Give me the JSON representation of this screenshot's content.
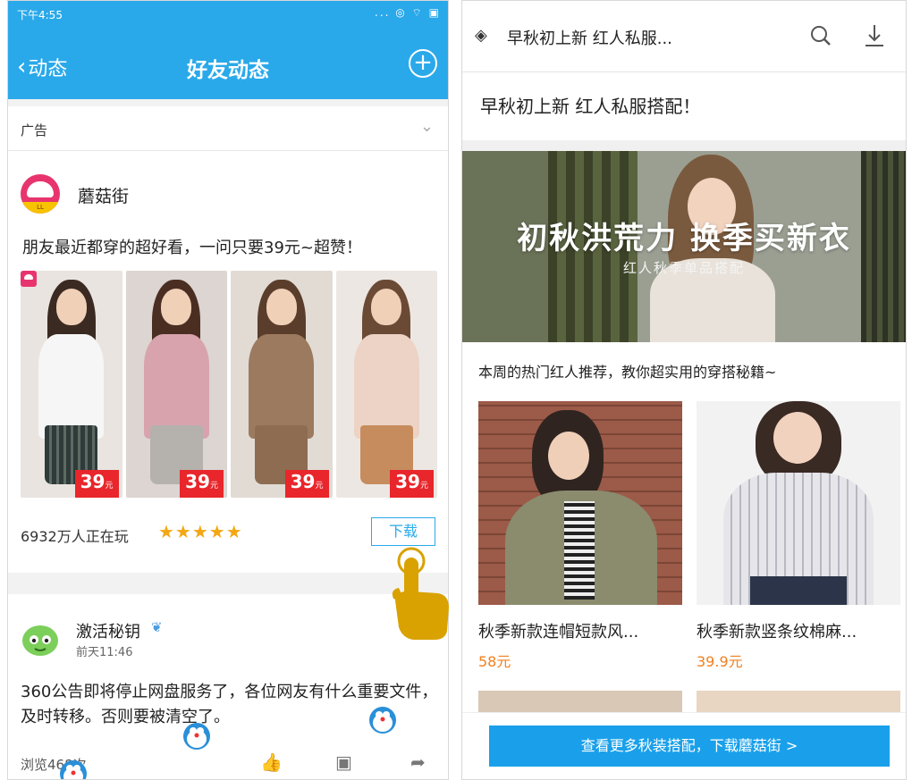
{
  "left_screen": {
    "status_time": "下午4:55",
    "status_icons": "... ◎ ⌔ ▣",
    "back_label": "动态",
    "title": "好友动态",
    "ad_label": "广告",
    "ad": {
      "name": "蘑菇街",
      "logo_text": "LL",
      "description": "朋友最近都穿的超好看，一问只要39元~超赞！",
      "prices": [
        {
          "value": "39",
          "unit": "元"
        },
        {
          "value": "39",
          "unit": "元"
        },
        {
          "value": "39",
          "unit": "元"
        },
        {
          "value": "39",
          "unit": "元"
        }
      ],
      "players": "6932万人正在玩",
      "rating": 4.5,
      "stars_text": "★★★★★",
      "download_label": "下载"
    },
    "post": {
      "name": "激活秘钥",
      "time": "前天11:46",
      "text": "360公告即将停止网盘服务了，各位网友有什么重要文件，及时转移。否则要被清空了。",
      "views": "浏览468次"
    }
  },
  "right_screen": {
    "nav_title": "早秋初上新 红人私服...",
    "page_title": "早秋初上新 红人私服搭配！",
    "banner_title": "初秋洪荒力 换季买新衣",
    "banner_subtitle": "红人秋季单品搭配",
    "intro": "本周的热门红人推荐，教你超实用的穿搭秘籍~",
    "products": [
      {
        "name": "秋季新款连帽短款风...",
        "price": "58元"
      },
      {
        "name": "秋季新款竖条纹棉麻...",
        "price": "39.9元"
      }
    ],
    "cta": "查看更多秋装搭配，下载蘑菇街 >"
  },
  "colors": {
    "header_blue": "#2aa9ea",
    "price_red": "#e8262b",
    "star_orange": "#f4a714",
    "price_orange": "#f08020",
    "cta_blue": "#1aa0ea"
  }
}
